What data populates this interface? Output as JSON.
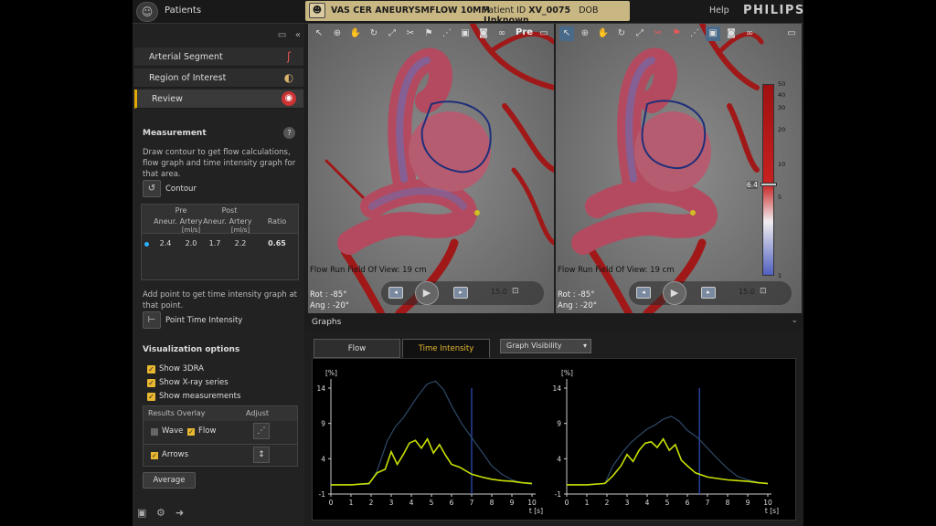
{
  "topbar": {
    "patients_label": "Patients",
    "exam_title": "VAS CER ANEURYSMFLOW 10MM",
    "patient_id_label": "Patient ID",
    "patient_id": "XV_0075",
    "dob_label": "DOB",
    "dob": "Unknown",
    "help": "Help",
    "brand": "PHILIPS"
  },
  "nav": {
    "items": [
      {
        "label": "Arterial Segment"
      },
      {
        "label": "Region of Interest"
      },
      {
        "label": "Review"
      }
    ]
  },
  "measurement": {
    "title": "Measurement",
    "desc": "Draw contour to get flow calculations, flow graph and time intensity graph for that area.",
    "contour_label": "Contour",
    "table": {
      "pre": "Pre",
      "post": "Post",
      "col_aneur": "Aneur.",
      "col_artery": "Artery",
      "unit": "[ml/s]",
      "col_ratio": "Ratio",
      "row": {
        "pre_aneur": "2.4",
        "pre_artery": "2.0",
        "post_aneur": "1.7",
        "post_artery": "2.2",
        "ratio": "0.65"
      }
    },
    "point_desc": "Add point to get time intensity graph at that point.",
    "point_label": "Point Time Intensity"
  },
  "visualization": {
    "title": "Visualization options",
    "options": [
      {
        "label": "Show 3DRA",
        "checked": true
      },
      {
        "label": "Show X-ray series",
        "checked": true
      },
      {
        "label": "Show measurements",
        "checked": true
      }
    ],
    "overlay": {
      "col_results": "Results Overlay",
      "col_adjust": "Adjust",
      "wave": "Wave",
      "flow": "Flow",
      "arrows": "Arrows"
    },
    "average_label": "Average"
  },
  "viewers": [
    {
      "tag": "Pre",
      "fov_label": "Flow Run Field Of View:",
      "fov_value": "19 cm",
      "rot": "Rot : -85°",
      "ang": "Ang : -20°",
      "playback_value": "15.0"
    },
    {
      "tag": "",
      "fov_label": "Flow Run Field Of View:",
      "fov_value": "19 cm",
      "rot": "Rot : -85°",
      "ang": "Ang : -20°",
      "playback_value": "15.0"
    }
  ],
  "colorscale": {
    "ticks": [
      "50",
      "40",
      "30",
      "20",
      "10",
      "5",
      "1"
    ],
    "current": "6.4"
  },
  "graphs": {
    "title": "Graphs",
    "tab_flow": "Flow",
    "tab_time_intensity": "Time Intensity",
    "visibility": "Graph Visibility"
  },
  "chart_data": [
    {
      "type": "line",
      "ylabel": "[%]",
      "xlabel": "t [s]",
      "xlim": [
        0,
        10
      ],
      "ylim": [
        -1,
        14
      ],
      "yticks": [
        "14",
        "9",
        "4",
        "-1"
      ],
      "xticks": [
        "0",
        "1",
        "2",
        "3",
        "4",
        "5",
        "6",
        "7",
        "8",
        "9",
        "10"
      ],
      "marker_x": 7.0,
      "series": [
        {
          "x": [
            0,
            1,
            1.9,
            2.3,
            2.8,
            3.2,
            3.6,
            4.0,
            4.4,
            4.8,
            5.2,
            5.6,
            6.0,
            6.5,
            7.0,
            7.5,
            8.0,
            8.5,
            9.0,
            9.5,
            10
          ],
          "values": [
            0.3,
            0.3,
            0.4,
            2.3,
            6.5,
            8.5,
            9.8,
            11.5,
            13.2,
            14.6,
            15.0,
            13.8,
            11.5,
            9.0,
            7.0,
            5.0,
            3.0,
            1.8,
            1.0,
            0.6,
            0.4
          ],
          "color": "#2d4a68"
        },
        {
          "x": [
            0,
            1,
            1.9,
            2.3,
            2.7,
            3.0,
            3.3,
            3.6,
            3.9,
            4.2,
            4.5,
            4.8,
            5.1,
            5.4,
            5.7,
            6.0,
            6.4,
            7.0,
            7.5,
            8.0,
            8.5,
            9.0,
            9.5,
            10
          ],
          "values": [
            0.3,
            0.3,
            0.5,
            2.0,
            2.5,
            5.0,
            3.2,
            4.6,
            6.2,
            6.6,
            5.5,
            6.8,
            4.8,
            6.0,
            4.5,
            3.2,
            2.8,
            1.8,
            1.4,
            1.1,
            0.9,
            0.8,
            0.6,
            0.5
          ],
          "color": "#c8e000"
        }
      ]
    },
    {
      "type": "line",
      "ylabel": "[%]",
      "xlabel": "t [s]",
      "xlim": [
        0,
        10
      ],
      "ylim": [
        -1,
        14
      ],
      "yticks": [
        "14",
        "9",
        "4",
        "-1"
      ],
      "xticks": [
        "0",
        "1",
        "2",
        "3",
        "4",
        "5",
        "6",
        "7",
        "8",
        "9",
        "10"
      ],
      "marker_x": 6.6,
      "series": [
        {
          "x": [
            0,
            1,
            1.9,
            2.3,
            2.8,
            3.2,
            3.6,
            4.0,
            4.4,
            4.8,
            5.2,
            5.6,
            6.0,
            6.5,
            7.0,
            7.5,
            8.0,
            8.5,
            9.0,
            9.5,
            10
          ],
          "values": [
            0.3,
            0.3,
            0.5,
            3.0,
            5.0,
            6.3,
            7.3,
            8.2,
            8.8,
            9.6,
            10.0,
            9.3,
            8.0,
            7.0,
            5.5,
            4.0,
            2.6,
            1.5,
            1.0,
            0.7,
            0.4
          ],
          "color": "#2d4a68"
        },
        {
          "x": [
            0,
            1,
            1.9,
            2.3,
            2.7,
            3.0,
            3.3,
            3.6,
            3.9,
            4.2,
            4.5,
            4.8,
            5.1,
            5.4,
            5.7,
            6.0,
            6.4,
            7.0,
            7.5,
            8.0,
            8.5,
            9.0,
            9.5,
            10
          ],
          "values": [
            0.3,
            0.3,
            0.5,
            1.6,
            3.0,
            4.6,
            3.6,
            5.2,
            6.2,
            6.4,
            5.6,
            6.8,
            5.2,
            6.0,
            3.8,
            3.0,
            2.0,
            1.4,
            1.2,
            1.0,
            0.9,
            0.8,
            0.6,
            0.5
          ],
          "color": "#c8e000"
        }
      ]
    }
  ]
}
